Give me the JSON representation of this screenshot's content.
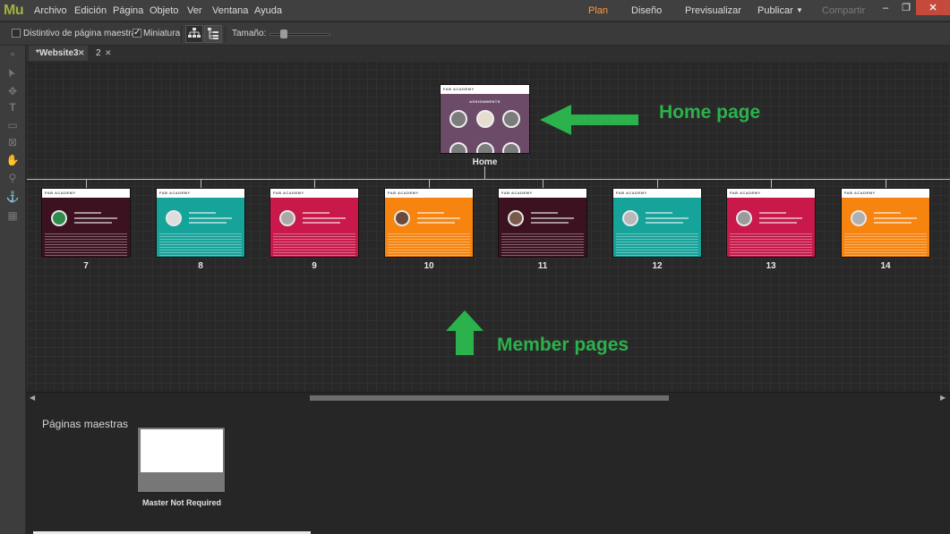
{
  "app": {
    "logo": "Mu"
  },
  "menu": [
    "Archivo",
    "Edición",
    "Página",
    "Objeto",
    "Ver",
    "Ventana",
    "Ayuda"
  ],
  "modes": {
    "plan": "Plan",
    "design": "Diseño",
    "preview": "Previsualizar",
    "publish": "Publicar",
    "share": "Compartir"
  },
  "window_controls": {
    "minimize": "–",
    "maximize": "❐",
    "close": "✕"
  },
  "toolbar": {
    "master_badge_label": "Distintivo de página maestra",
    "master_badge_checked": false,
    "thumbnail_label": "Miniatura",
    "thumbnail_checked": true,
    "size_label": "Tamaño:",
    "size_value": 0.2
  },
  "tabs": [
    {
      "label": "*Website3",
      "active": true
    },
    {
      "label": "2",
      "active": false
    }
  ],
  "site_plan": {
    "home": {
      "label": "Home",
      "heading": "ASSIGNMENTS",
      "brand": "FAB ACADEMY"
    },
    "pages": [
      {
        "label": "7",
        "color": "#3d1220",
        "accent": "#2f8c4a"
      },
      {
        "label": "8",
        "color": "#15a39a",
        "accent": "#dddddd"
      },
      {
        "label": "9",
        "color": "#c8194a",
        "accent": "#a9a9a9"
      },
      {
        "label": "10",
        "color": "#f7840f",
        "accent": "#6b4a3a"
      },
      {
        "label": "11",
        "color": "#3d1220",
        "accent": "#7a5a4a"
      },
      {
        "label": "12",
        "color": "#15a39a",
        "accent": "#b8b8b8"
      },
      {
        "label": "13",
        "color": "#c8194a",
        "accent": "#9a9a9a"
      },
      {
        "label": "14",
        "color": "#f7840f",
        "accent": "#b0b0b0"
      }
    ],
    "brand": "FAB ACADEMY"
  },
  "annotations": {
    "home": "Home page",
    "members": "Member pages",
    "color": "#2bb24c"
  },
  "master": {
    "title": "Páginas maestras",
    "label": "Master Not Required"
  }
}
